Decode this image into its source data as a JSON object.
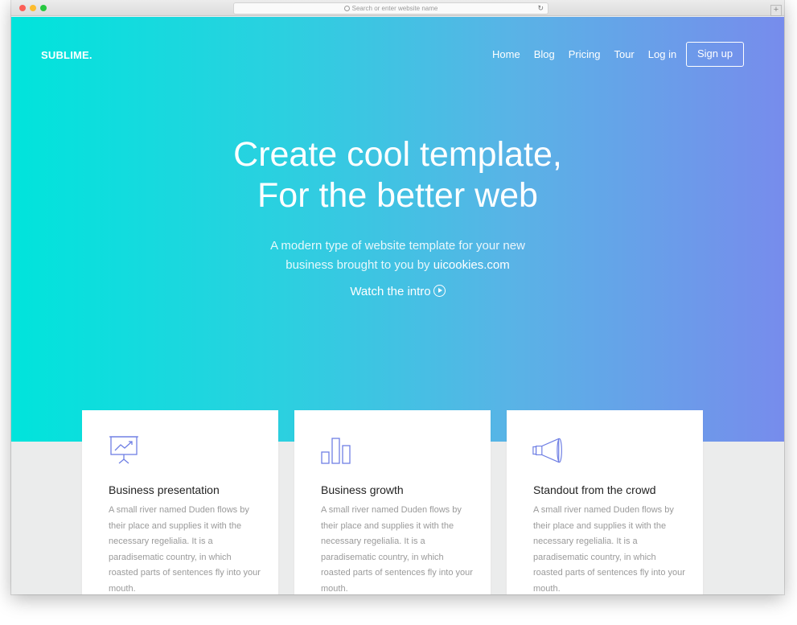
{
  "browser": {
    "url_placeholder": "Search or enter website name",
    "reload_icon": "reload-icon",
    "new_tab_label": "+"
  },
  "site": {
    "brand": "SUBLIME.",
    "nav": [
      "Home",
      "Blog",
      "Pricing",
      "Tour",
      "Log in"
    ],
    "signup_label": "Sign up"
  },
  "hero": {
    "headline_line1": "Create cool template,",
    "headline_line2": "For the better web",
    "sub_line1": "A modern type of website template for your new",
    "sub_line2_prefix": "business brought to you by ",
    "sub_link": "uicookies.com",
    "watch_label": "Watch the intro"
  },
  "features": [
    {
      "icon": "presentation-icon",
      "title": "Business presentation",
      "text": "A small river named Duden flows by their place and supplies it with the necessary regelialia. It is a paradisematic country, in which roasted parts of sentences fly into your mouth."
    },
    {
      "icon": "bar-chart-icon",
      "title": "Business growth",
      "text": "A small river named Duden flows by their place and supplies it with the necessary regelialia. It is a paradisematic country, in which roasted parts of sentences fly into your mouth."
    },
    {
      "icon": "megaphone-icon",
      "title": "Standout from the crowd",
      "text": "A small river named Duden flows by their place and supplies it with the necessary regelialia. It is a paradisematic country, in which roasted parts of sentences fly into your mouth."
    }
  ],
  "colors": {
    "gradient_start": "#00e4dc",
    "gradient_end": "#778cec",
    "icon_stroke": "#6f7fe4"
  }
}
